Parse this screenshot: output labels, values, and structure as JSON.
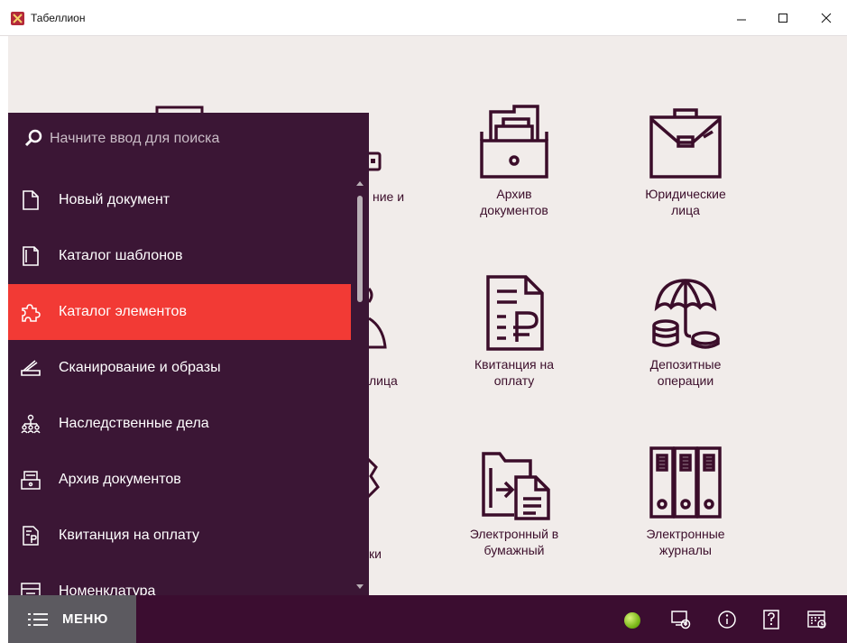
{
  "window": {
    "title": "Табеллион"
  },
  "search": {
    "placeholder": "Начните ввод для поиска"
  },
  "menu": {
    "items": [
      {
        "label": "Новый документ",
        "icon": "document-icon",
        "active": false
      },
      {
        "label": "Каталог шаблонов",
        "icon": "templates-icon",
        "active": false
      },
      {
        "label": "Каталог элементов",
        "icon": "puzzle-icon",
        "active": true
      },
      {
        "label": "Сканирование и образы",
        "icon": "scanner-icon",
        "active": false
      },
      {
        "label": "Наследственные дела",
        "icon": "family-tree-icon",
        "active": false
      },
      {
        "label": "Архив документов",
        "icon": "archive-icon",
        "active": false
      },
      {
        "label": "Квитанция на оплату",
        "icon": "receipt-icon",
        "active": false
      },
      {
        "label": "Номенклатура",
        "icon": "nomenclature-icon",
        "active": false
      }
    ]
  },
  "tiles": [
    {
      "label": "Архив\nдокументов",
      "icon": "archive-drawer-icon"
    },
    {
      "label": "Юридические\nлица",
      "icon": "briefcase-icon"
    },
    {
      "label": "Квитанция на\nоплату",
      "icon": "ruble-receipt-icon"
    },
    {
      "label": "Депозитные\nоперации",
      "icon": "deposit-umbrella-icon"
    },
    {
      "label": "Электронный в\nбумажный",
      "icon": "folder-convert-icon"
    },
    {
      "label": "Электронные\nжурналы",
      "icon": "binders-icon"
    }
  ],
  "partial_tiles": {
    "frag1": "ние и",
    "frag2": "лица",
    "frag3": "ки"
  },
  "bottombar": {
    "menu_label": "МЕНЮ",
    "status_color": "#7cb91a",
    "icons": [
      "remote-desktop-icon",
      "info-icon",
      "help-icon",
      "calendar-icon"
    ]
  },
  "colors": {
    "accent": "#f23a35",
    "panel": "#3b1635",
    "bar": "#3b0d30",
    "icon": "#3b0d2a"
  }
}
